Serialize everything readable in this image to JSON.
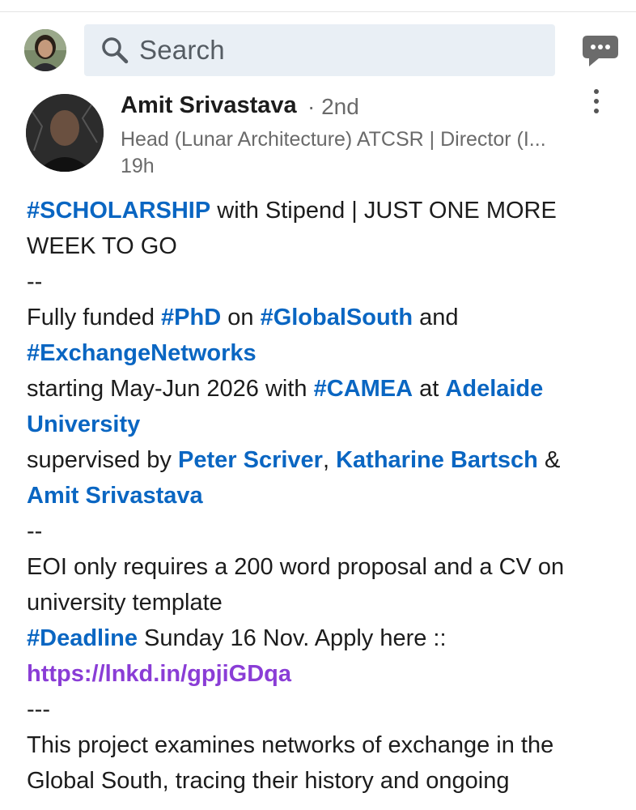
{
  "search": {
    "placeholder": "Search"
  },
  "post": {
    "author": "Amit Srivastava",
    "degree": "· 2nd",
    "headline": "Head (Lunar Architecture) ATCSR | Director (I...",
    "time": "19h",
    "lines": [
      [
        {
          "t": "#SCHOLARSHIP",
          "k": "tag"
        },
        {
          "t": " with Stipend | JUST ONE MORE",
          "k": "text"
        }
      ],
      [
        {
          "t": "WEEK TO GO",
          "k": "text"
        }
      ],
      [
        {
          "t": "--",
          "k": "text"
        }
      ],
      [
        {
          "t": "Fully funded ",
          "k": "text"
        },
        {
          "t": "#PhD",
          "k": "tag"
        },
        {
          "t": " on ",
          "k": "text"
        },
        {
          "t": "#GlobalSouth",
          "k": "tag"
        },
        {
          "t": " and",
          "k": "text"
        }
      ],
      [
        {
          "t": "#ExchangeNetworks",
          "k": "tag"
        }
      ],
      [
        {
          "t": "starting May-Jun 2026 with ",
          "k": "text"
        },
        {
          "t": "#CAMEA",
          "k": "tag"
        },
        {
          "t": " at ",
          "k": "text"
        },
        {
          "t": "Adelaide",
          "k": "mention"
        }
      ],
      [
        {
          "t": "University",
          "k": "mention"
        }
      ],
      [
        {
          "t": "supervised by ",
          "k": "text"
        },
        {
          "t": "Peter Scriver",
          "k": "mention"
        },
        {
          "t": ", ",
          "k": "text"
        },
        {
          "t": "Katharine Bartsch",
          "k": "mention"
        },
        {
          "t": " &",
          "k": "text"
        }
      ],
      [
        {
          "t": "Amit Srivastava",
          "k": "mention"
        }
      ],
      [
        {
          "t": "--",
          "k": "text"
        }
      ],
      [
        {
          "t": "EOI only requires a 200 word proposal and a CV on",
          "k": "text"
        }
      ],
      [
        {
          "t": "university template",
          "k": "text"
        }
      ],
      [
        {
          "t": "#Deadline",
          "k": "tag"
        },
        {
          "t": " Sunday 16 Nov. Apply here ::",
          "k": "text"
        }
      ],
      [
        {
          "t": "https://lnkd.in/gpjiGDqa",
          "k": "link"
        }
      ],
      [
        {
          "t": "---",
          "k": "text"
        }
      ],
      [
        {
          "t": "This project examines networks of exchange in the",
          "k": "text"
        }
      ],
      [
        {
          "t": "Global South, tracing their history and ongoing",
          "k": "text"
        }
      ]
    ]
  },
  "icons": {
    "search": "search-icon",
    "messaging": "messaging-icon",
    "more": "more-options-icon"
  },
  "colors": {
    "hashtag": "#0a66c2",
    "link": "#8a3dd6",
    "search_bg": "#e9eff5",
    "muted_text": "#6a6a6a"
  }
}
